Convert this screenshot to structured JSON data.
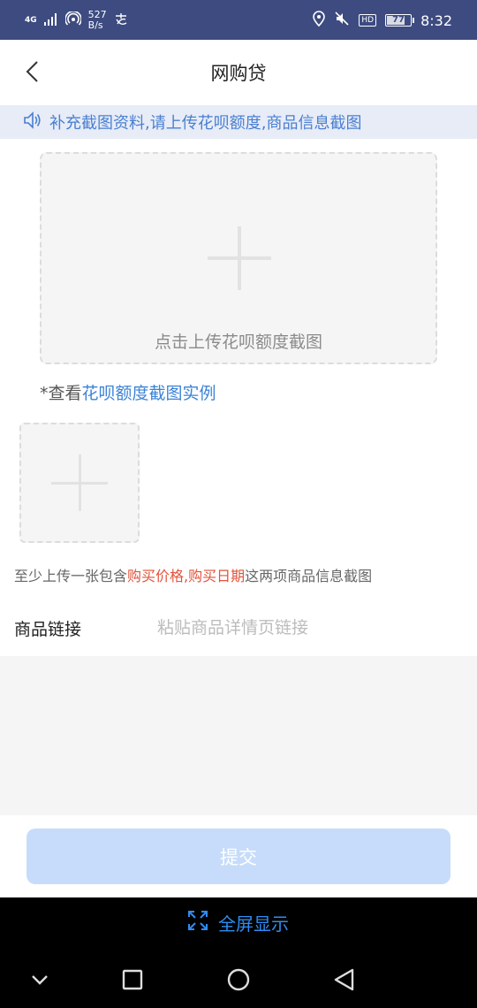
{
  "status_bar": {
    "network_type": "4G",
    "net_speed_value": "527",
    "net_speed_unit": "B/s",
    "battery_level": "77",
    "time": "8:32"
  },
  "header": {
    "title": "网购贷"
  },
  "notice": {
    "text": "补充截图资料,请上传花呗额度,商品信息截图"
  },
  "upload_main": {
    "label": "点击上传花呗额度截图"
  },
  "example": {
    "prefix": "*查看",
    "link_text": "花呗额度截图实例"
  },
  "hint": {
    "part1": "至少上传一张包含",
    "highlight1": "购买价格,",
    "highlight2": "购买日期",
    "part2": "这两项商品信息截图"
  },
  "product_link": {
    "label": "商品链接",
    "placeholder": "粘贴商品详情页链接",
    "value": ""
  },
  "submit": {
    "label": "提交"
  },
  "fullscreen": {
    "label": "全屏显示"
  },
  "colors": {
    "status_bar": "#3d4b80",
    "accent": "#3c83d6",
    "highlight": "#e2533a",
    "submit_disabled": "#c6dcfa"
  }
}
